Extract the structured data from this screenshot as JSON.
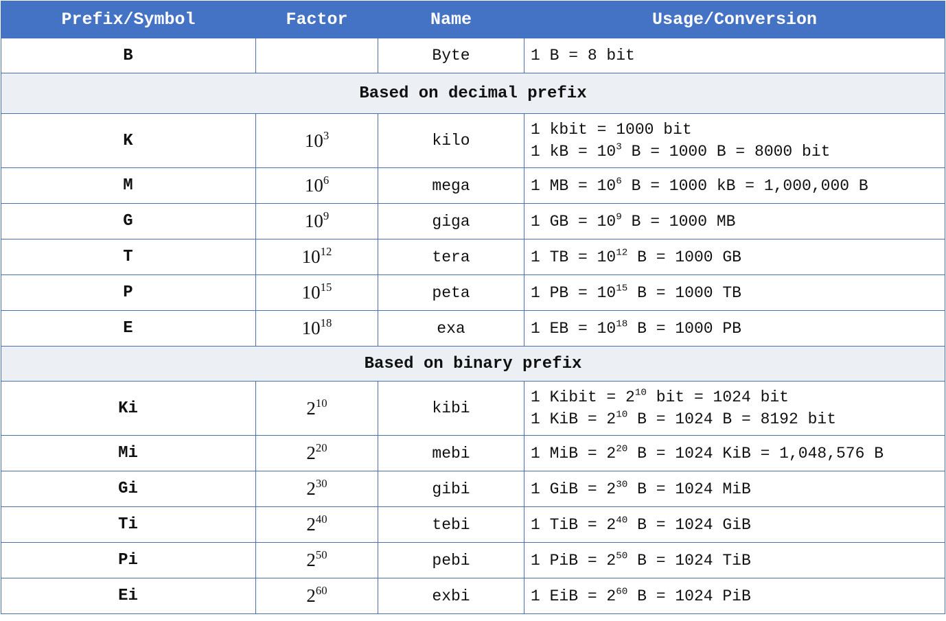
{
  "header": {
    "col_prefix": "Prefix/Symbol",
    "col_factor": "Factor",
    "col_name": "Name",
    "col_usage": "Usage/Conversion"
  },
  "byte_row": {
    "symbol": "B",
    "factor": "",
    "name": "Byte",
    "usage": "1 B = 8 bit"
  },
  "decimal_section": {
    "title": "Based on decimal prefix",
    "rows": [
      {
        "symbol": "K",
        "base": "10",
        "exp": "3",
        "name": "kilo",
        "usage": [
          [
            {
              "t": "1 kbit = 1000 bit"
            }
          ],
          [
            {
              "t": "1 kB = 10"
            },
            {
              "sup": "3"
            },
            {
              "t": " B = 1000 B = 8000 bit"
            }
          ]
        ]
      },
      {
        "symbol": "M",
        "base": "10",
        "exp": "6",
        "name": "mega",
        "usage": [
          [
            {
              "t": "1 MB = 10"
            },
            {
              "sup": "6"
            },
            {
              "t": " B = 1000 kB = 1,000,000 B"
            }
          ]
        ]
      },
      {
        "symbol": "G",
        "base": "10",
        "exp": "9",
        "name": "giga",
        "usage": [
          [
            {
              "t": "1 GB = 10"
            },
            {
              "sup": "9"
            },
            {
              "t": " B = 1000 MB"
            }
          ]
        ]
      },
      {
        "symbol": "T",
        "base": "10",
        "exp": "12",
        "name": "tera",
        "usage": [
          [
            {
              "t": "1 TB = 10"
            },
            {
              "sup": "12"
            },
            {
              "t": " B = 1000 GB"
            }
          ]
        ]
      },
      {
        "symbol": "P",
        "base": "10",
        "exp": "15",
        "name": "peta",
        "usage": [
          [
            {
              "t": "1 PB = 10"
            },
            {
              "sup": "15"
            },
            {
              "t": " B = 1000 TB"
            }
          ]
        ]
      },
      {
        "symbol": "E",
        "base": "10",
        "exp": "18",
        "name": "exa",
        "usage": [
          [
            {
              "t": "1 EB = 10"
            },
            {
              "sup": "18"
            },
            {
              "t": " B = 1000 PB"
            }
          ]
        ]
      }
    ]
  },
  "binary_section": {
    "title": "Based on binary prefix",
    "rows": [
      {
        "symbol": "Ki",
        "base": "2",
        "exp": "10",
        "name": "kibi",
        "usage": [
          [
            {
              "t": "1 Kibit = 2"
            },
            {
              "sup": "10"
            },
            {
              "t": " bit = 1024 bit"
            }
          ],
          [
            {
              "t": "1 KiB = 2"
            },
            {
              "sup": "10"
            },
            {
              "t": " B = 1024 B = 8192 bit"
            }
          ]
        ]
      },
      {
        "symbol": "Mi",
        "base": "2",
        "exp": "20",
        "name": "mebi",
        "usage": [
          [
            {
              "t": "1 MiB = 2"
            },
            {
              "sup": "20"
            },
            {
              "t": " B = 1024 KiB = 1,048,576 B"
            }
          ]
        ]
      },
      {
        "symbol": "Gi",
        "base": "2",
        "exp": "30",
        "name": "gibi",
        "usage": [
          [
            {
              "t": "1 GiB = 2"
            },
            {
              "sup": "30"
            },
            {
              "t": " B = 1024 MiB"
            }
          ]
        ]
      },
      {
        "symbol": "Ti",
        "base": "2",
        "exp": "40",
        "name": "tebi",
        "usage": [
          [
            {
              "t": "1 TiB = 2"
            },
            {
              "sup": "40"
            },
            {
              "t": " B = 1024 GiB"
            }
          ]
        ]
      },
      {
        "symbol": "Pi",
        "base": "2",
        "exp": "50",
        "name": "pebi",
        "usage": [
          [
            {
              "t": "1 PiB = 2"
            },
            {
              "sup": "50"
            },
            {
              "t": " B = 1024 TiB"
            }
          ]
        ]
      },
      {
        "symbol": "Ei",
        "base": "2",
        "exp": "60",
        "name": "exbi",
        "usage": [
          [
            {
              "t": "1 EiB = 2"
            },
            {
              "sup": "60"
            },
            {
              "t": " B = 1024 PiB"
            }
          ]
        ]
      }
    ]
  },
  "colors": {
    "header_bg": "#4472c4",
    "header_text": "#ffffff",
    "section_bg": "#eceff3",
    "border": "#4a6fb0"
  }
}
